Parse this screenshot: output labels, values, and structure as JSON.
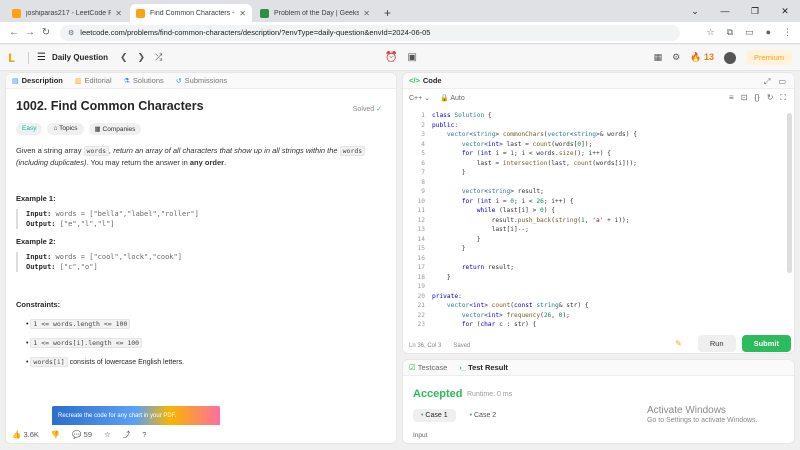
{
  "browser": {
    "tabs": [
      {
        "title": "joshiparas217 - LeetCode Profi",
        "color": "#ffa116"
      },
      {
        "title": "Find Common Characters - Leet",
        "color": "#ffa116"
      },
      {
        "title": "Problem of the Day | GeeksforG",
        "color": "#2f8d46"
      }
    ],
    "url": "leetcode.com/problems/find-common-characters/description/?envType=daily-question&envId=2024-06-05"
  },
  "nav": {
    "section": "Daily Question",
    "streak": "13",
    "premium": "Premium"
  },
  "left": {
    "tabs": [
      "Description",
      "Editorial",
      "Solutions",
      "Submissions"
    ],
    "title": "1002. Find Common Characters",
    "solved": "Solved",
    "chips": [
      "Easy",
      "Topics",
      "Companies"
    ],
    "desc_1": "Given a string array ",
    "desc_code1": "words",
    "desc_2": ", return an array of all characters that show up in all strings within the ",
    "desc_code2": "words",
    "desc_3": " (including duplicates)",
    "desc_4": ". You may return the answer in ",
    "desc_5": "any order",
    "desc_6": ".",
    "ex1_title": "Example 1:",
    "ex1_in_lbl": "Input:",
    "ex1_in": "words = [\"bella\",\"label\",\"roller\"]",
    "ex1_out_lbl": "Output:",
    "ex1_out": "[\"e\",\"l\",\"l\"]",
    "ex2_title": "Example 2:",
    "ex2_in_lbl": "Input:",
    "ex2_in": "words = [\"cool\",\"lock\",\"cook\"]",
    "ex2_out_lbl": "Output:",
    "ex2_out": "[\"c\",\"o\"]",
    "constraints_title": "Constraints:",
    "c1": "1 <= words.length <= 100",
    "c2": "1 <= words[i].length <= 100",
    "c3_code": "words[i]",
    "c3_text": " consists of lowercase English letters.",
    "ad_text": "Recreate the code for any chart in your PDF.",
    "likes": "3.6K",
    "comments": "59"
  },
  "code": {
    "header": "Code",
    "lang": "C++",
    "mode": "Auto",
    "status": "Ln 36, Col 3",
    "saved": "Saved",
    "run": "Run",
    "submit": "Submit"
  },
  "result": {
    "tab1": "Testcase",
    "tab2": "Test Result",
    "verdict": "Accepted",
    "runtime": "Runtime: 0 ms",
    "case1": "Case 1",
    "case2": "Case 2",
    "input_label": "Input"
  },
  "watermark": {
    "title": "Activate Windows",
    "sub": "Go to Settings to activate Windows."
  }
}
